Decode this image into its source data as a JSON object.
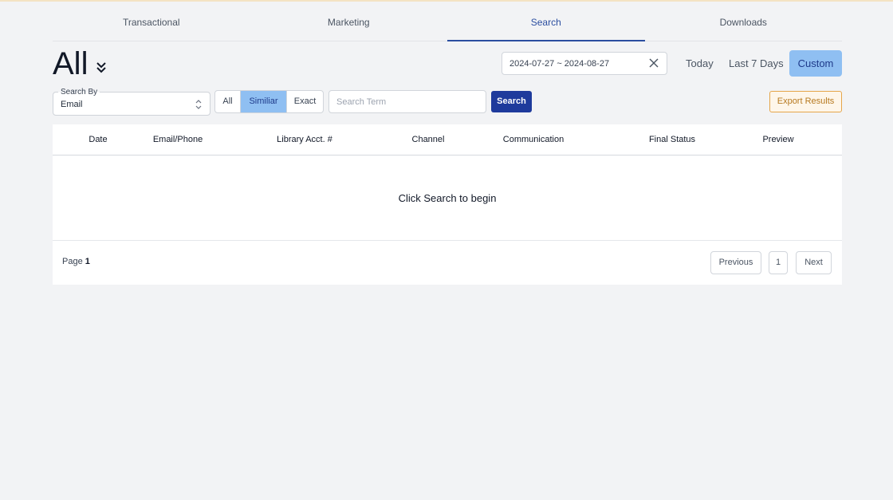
{
  "tabs": [
    {
      "label": "Transactional",
      "active": false
    },
    {
      "label": "Marketing",
      "active": false
    },
    {
      "label": "Search",
      "active": true
    },
    {
      "label": "Downloads",
      "active": false
    }
  ],
  "heading": {
    "title": "All",
    "dropdown_icon": "double-chevron-down-icon"
  },
  "date_range": {
    "value": "2024-07-27 ~ 2024-08-27",
    "clear_icon": "close-icon"
  },
  "range_buttons": {
    "today": "Today",
    "last7": "Last 7 Days",
    "custom": "Custom",
    "selected": "Custom"
  },
  "search_by": {
    "label": "Search By",
    "value": "Email"
  },
  "match_mode": {
    "options": [
      "All",
      "Similiar",
      "Exact"
    ],
    "selected": "Similiar"
  },
  "search_term": {
    "placeholder": "Search Term",
    "value": ""
  },
  "buttons": {
    "search": "Search",
    "export": "Export Results"
  },
  "table": {
    "columns": [
      "Date",
      "Email/Phone",
      "Library Acct. #",
      "Channel",
      "Communication",
      "Final Status",
      "Preview"
    ],
    "empty_message": "Click Search to begin"
  },
  "pagination": {
    "page_label": "Page",
    "current_page": "1",
    "previous": "Previous",
    "page_1": "1",
    "next": "Next"
  },
  "colors": {
    "accent": "#2b4ea0",
    "selected_bg": "#8fbff2",
    "search_btn": "#1e3a9c",
    "export_border": "#e5a54a"
  }
}
